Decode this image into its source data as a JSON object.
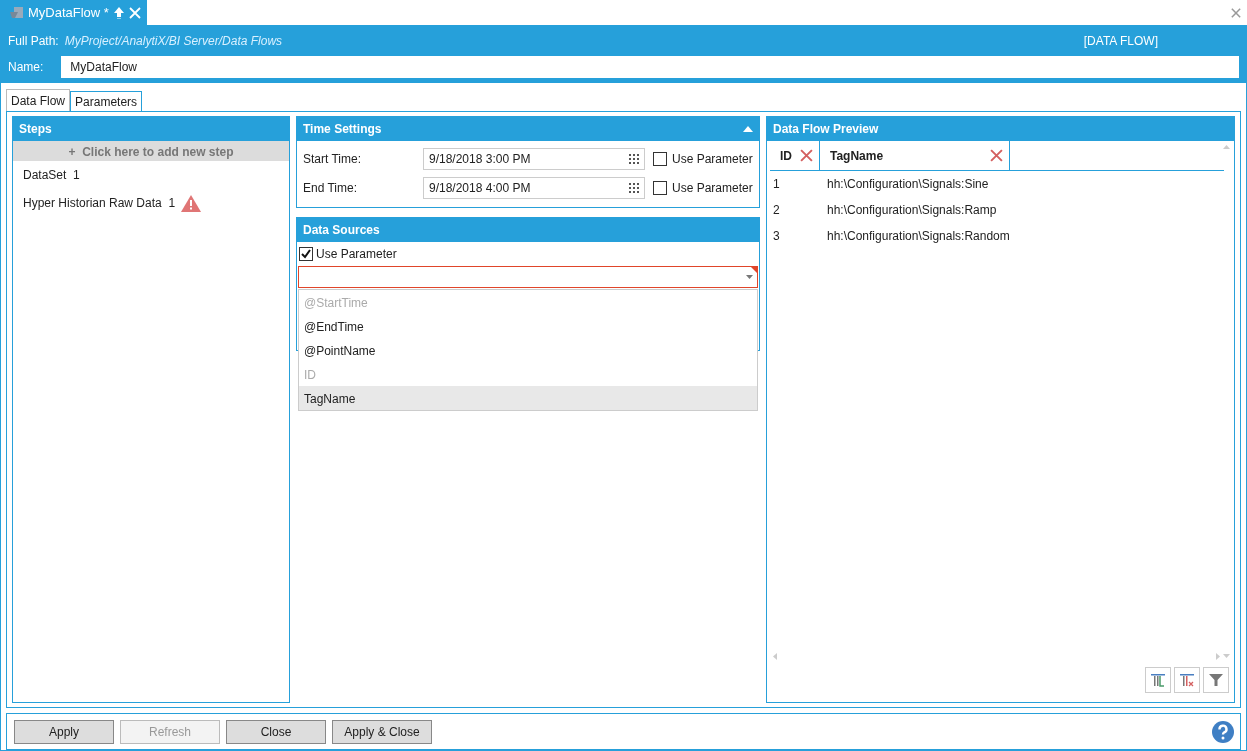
{
  "document_tab": {
    "title": "MyDataFlow *"
  },
  "header": {
    "full_path_label": "Full Path:",
    "full_path": "MyProject/AnalytiX/BI Server/Data Flows",
    "type_label": "[DATA FLOW]",
    "name_label": "Name:",
    "name_value": "MyDataFlow"
  },
  "tabs": [
    {
      "label": "Data Flow",
      "selected": true
    },
    {
      "label": "Parameters",
      "selected": false
    }
  ],
  "steps": {
    "title": "Steps",
    "add_icon": "+",
    "add_label": "Click here to add new step",
    "items": [
      {
        "name": "DataSet",
        "count": "1",
        "warning": false
      },
      {
        "name": "Hyper Historian Raw Data",
        "count": "1",
        "warning": true
      }
    ]
  },
  "time_settings": {
    "title": "Time Settings",
    "expanded": true,
    "rows": [
      {
        "label": "Start Time:",
        "value": "9/18/2018 3:00 PM",
        "param_label": "Use Parameter",
        "checked": false
      },
      {
        "label": "End Time:",
        "value": "9/18/2018 4:00 PM",
        "param_label": "Use Parameter",
        "checked": false
      }
    ]
  },
  "data_sources": {
    "title": "Data Sources",
    "param_label": "Use Parameter",
    "checked": true,
    "invalid": true,
    "open": true,
    "options": [
      {
        "label": "@StartTime",
        "disabled": true,
        "selected": false
      },
      {
        "label": "@EndTime",
        "disabled": false,
        "selected": false
      },
      {
        "label": "@PointName",
        "disabled": false,
        "selected": false
      },
      {
        "label": "ID",
        "disabled": true,
        "selected": false
      },
      {
        "label": "TagName",
        "disabled": false,
        "selected": true
      }
    ]
  },
  "preview": {
    "title": "Data Flow Preview",
    "columns": [
      "ID",
      "TagName"
    ],
    "rows": [
      [
        "1",
        "hh:\\Configuration\\Signals:Sine"
      ],
      [
        "2",
        "hh:\\Configuration\\Signals:Ramp"
      ],
      [
        "3",
        "hh:\\Configuration\\Signals:Random"
      ]
    ]
  },
  "buttons": [
    {
      "label": "Apply",
      "disabled": false
    },
    {
      "label": "Refresh",
      "disabled": true
    },
    {
      "label": "Close",
      "disabled": false
    },
    {
      "label": "Apply & Close",
      "disabled": false
    }
  ]
}
